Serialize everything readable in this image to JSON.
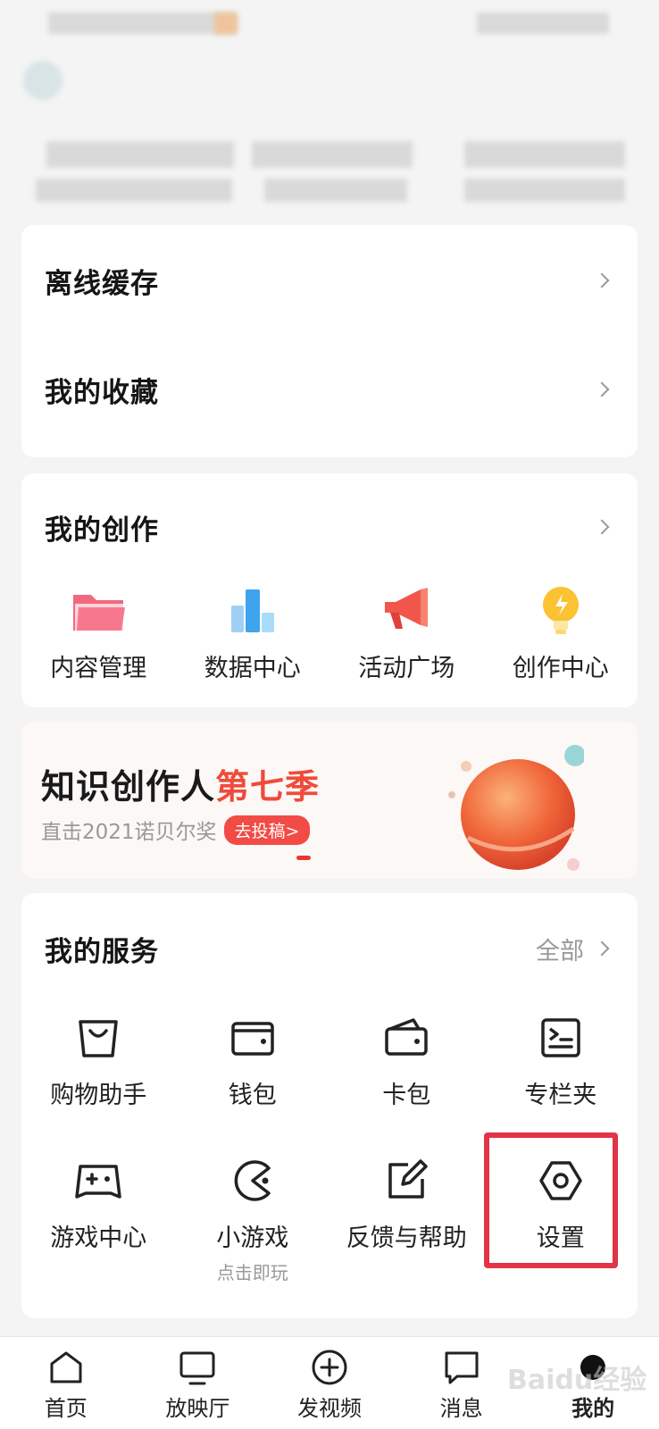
{
  "list_card": {
    "items": [
      {
        "label": "离线缓存"
      },
      {
        "label": "我的收藏"
      }
    ]
  },
  "creation": {
    "title": "我的创作",
    "items": [
      {
        "label": "内容管理",
        "icon": "folder-icon"
      },
      {
        "label": "数据中心",
        "icon": "bar-chart-icon"
      },
      {
        "label": "活动广场",
        "icon": "megaphone-icon"
      },
      {
        "label": "创作中心",
        "icon": "lightbulb-icon"
      }
    ]
  },
  "banner": {
    "title_main": "知识创作人",
    "title_accent": "第七季",
    "subtitle": "直击2021诺贝尔奖",
    "button": "去投稿>"
  },
  "services": {
    "title": "我的服务",
    "all_label": "全部",
    "row1": [
      {
        "label": "购物助手",
        "icon": "shopping-bag-icon"
      },
      {
        "label": "钱包",
        "icon": "wallet-icon"
      },
      {
        "label": "卡包",
        "icon": "card-holder-icon"
      },
      {
        "label": "专栏夹",
        "icon": "column-folder-icon"
      }
    ],
    "row2": [
      {
        "label": "游戏中心",
        "icon": "gamepad-icon"
      },
      {
        "label": "小游戏",
        "sub": "点击即玩",
        "icon": "pacman-icon"
      },
      {
        "label": "反馈与帮助",
        "icon": "edit-icon"
      },
      {
        "label": "设置",
        "icon": "settings-hex-icon"
      }
    ]
  },
  "tabbar": [
    {
      "label": "首页",
      "icon": "home-icon"
    },
    {
      "label": "放映厅",
      "icon": "tv-icon"
    },
    {
      "label": "发视频",
      "icon": "plus-circle-icon"
    },
    {
      "label": "消息",
      "icon": "message-icon"
    },
    {
      "label": "我的",
      "icon": "avatar-icon",
      "active": true
    }
  ],
  "watermark": "Baidu经验",
  "colors": {
    "accent_red": "#f04a3a",
    "highlight_box": "#e23347"
  }
}
